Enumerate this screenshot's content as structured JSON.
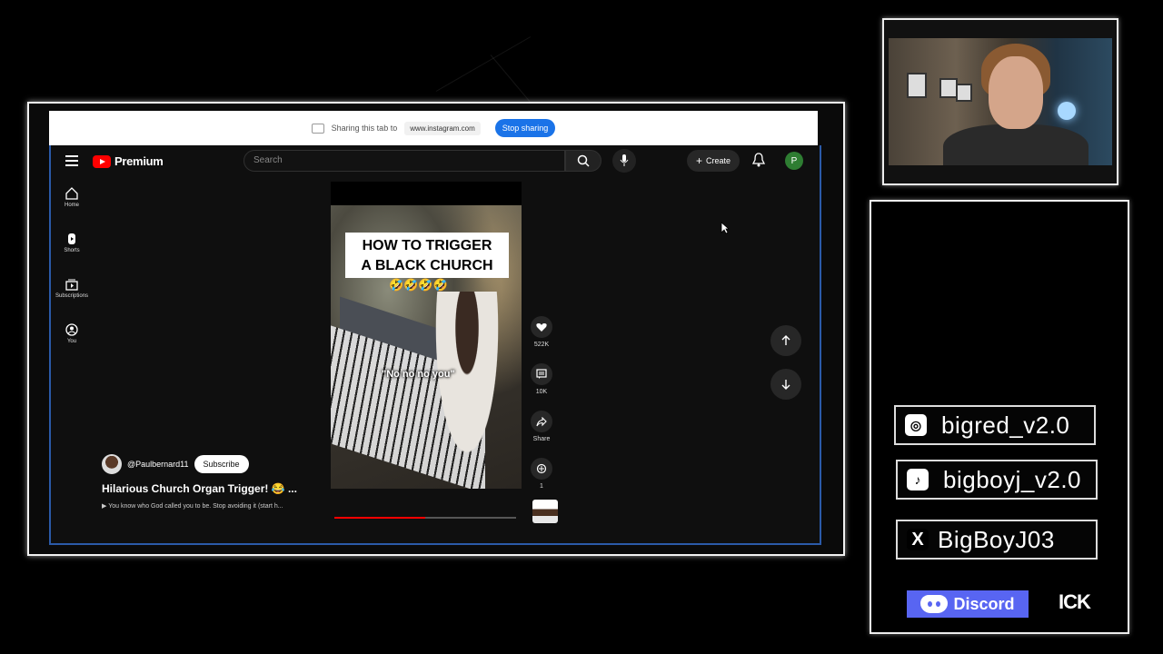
{
  "share_bar": {
    "message": "Sharing this tab to",
    "url": "www.instagram.com",
    "stop_label": "Stop sharing"
  },
  "youtube": {
    "logo_text": "Premium",
    "search_placeholder": "Search",
    "create_label": "Create",
    "avatar_letter": "P",
    "sidebar": [
      {
        "label": "Home",
        "icon": "home-icon"
      },
      {
        "label": "Shorts",
        "icon": "shorts-icon"
      },
      {
        "label": "Subscriptions",
        "icon": "subscriptions-icon"
      },
      {
        "label": "You",
        "icon": "you-icon"
      }
    ],
    "video": {
      "caption_line1": "HOW TO TRIGGER",
      "caption_line2": "A BLACK CHURCH",
      "emojis": "🤣🤣🤣🤣",
      "subtitle": "\"No no no you\"",
      "progress": 0.5
    },
    "actions": {
      "likes": "522K",
      "comments": "10K",
      "share": "Share",
      "remix": "1"
    },
    "meta": {
      "handle": "@Paulbernard11",
      "subscribe_label": "Subscribe",
      "title": "Hilarious Church Organ Trigger! 😂 ...",
      "description": "▶ You know who God called you to be. Stop avoiding it (start h..."
    }
  },
  "socials": [
    {
      "icon": "instagram-icon",
      "handle": "bigred_v2.0"
    },
    {
      "icon": "tiktok-icon",
      "handle": "bigboyj_v2.0"
    },
    {
      "icon": "x-icon",
      "handle": "BigBoyJ03"
    }
  ],
  "discord_label": "Discord",
  "kick_label": "ICK",
  "colors": {
    "accent_red": "#ff0000",
    "stop_sharing_blue": "#1a73e8",
    "discord": "#5865f2",
    "avatar_green": "#2e7d32"
  }
}
